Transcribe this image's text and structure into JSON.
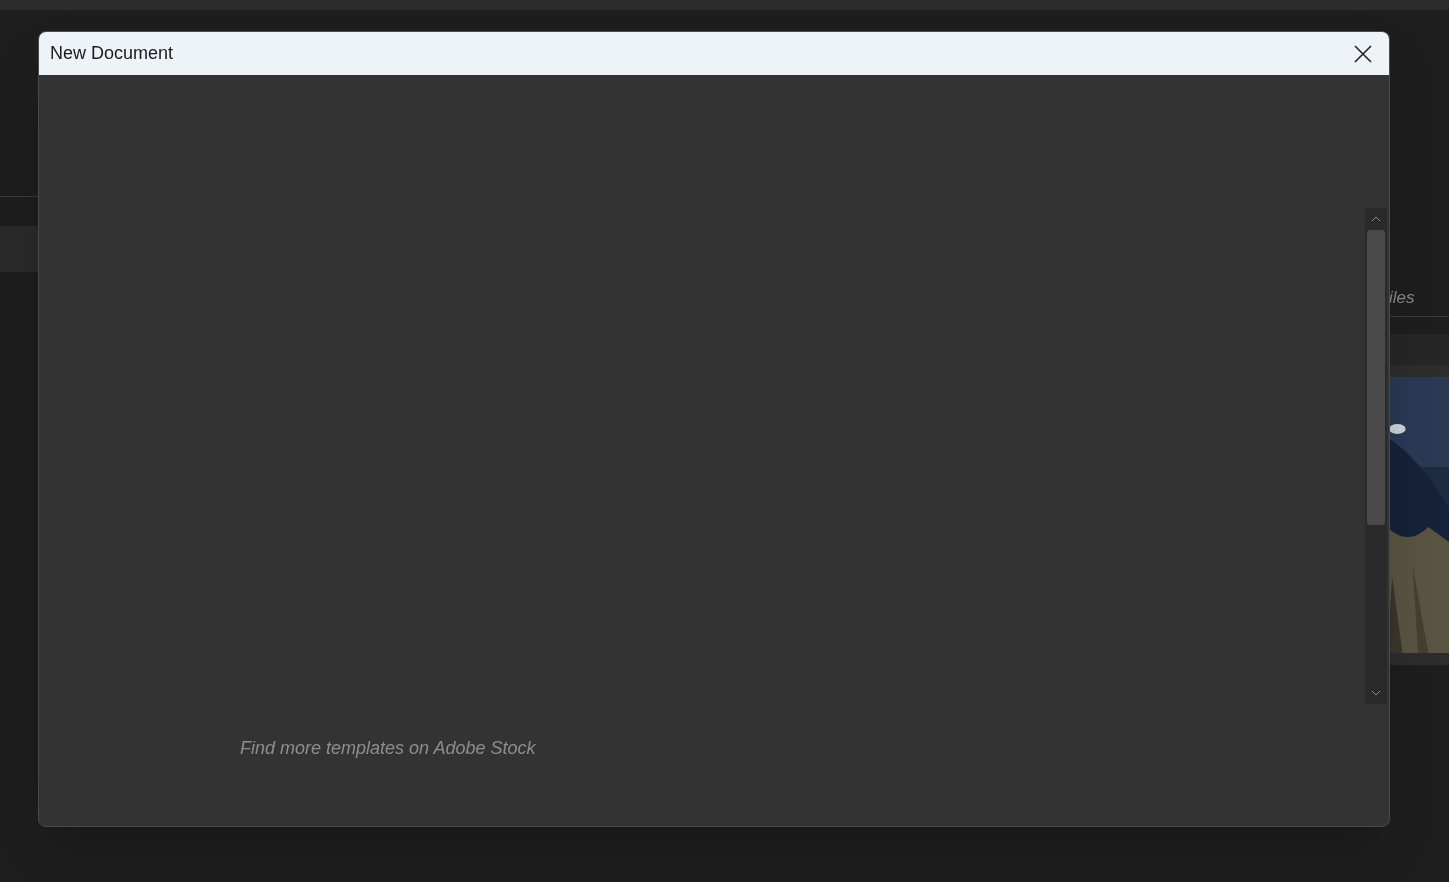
{
  "background": {
    "section_label": "iles"
  },
  "dialog": {
    "title": "New Document",
    "stock_link": "Find more templates on Adobe Stock"
  }
}
